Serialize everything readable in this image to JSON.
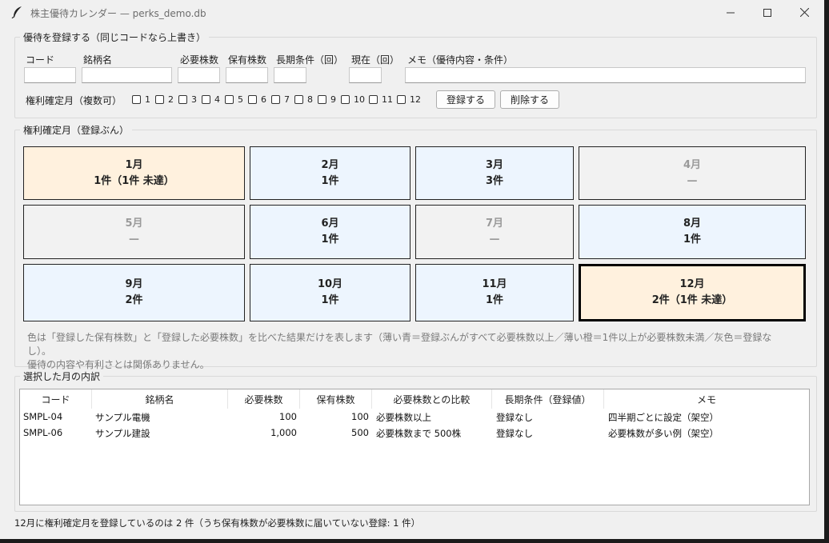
{
  "window": {
    "title": "株主優待カレンダー — perks_demo.db"
  },
  "register": {
    "legend": "優待を登録する（同じコードなら上書き）",
    "labels": {
      "code": "コード",
      "name": "銘柄名",
      "required": "必要株数",
      "held": "保有株数",
      "long_term": "長期条件（回）",
      "current": "現在（回）",
      "memo": "メモ（優待内容・条件）"
    },
    "values": {
      "code": "",
      "name": "",
      "required": "",
      "held": "",
      "long_term": "",
      "current": "",
      "memo": ""
    },
    "months_label": "権利確定月（複数可）",
    "month_checks": [
      "1",
      "2",
      "3",
      "4",
      "5",
      "6",
      "7",
      "8",
      "9",
      "10",
      "11",
      "12"
    ],
    "register_button": "登録する",
    "delete_button": "削除する"
  },
  "calendar": {
    "legend": "権利確定月（登録ぶん）",
    "months": [
      {
        "month": "1月",
        "summary": "1件（1件 未達）",
        "status": "orange"
      },
      {
        "month": "2月",
        "summary": "1件",
        "status": "blue"
      },
      {
        "month": "3月",
        "summary": "3件",
        "status": "blue"
      },
      {
        "month": "4月",
        "summary": "—",
        "status": "gray"
      },
      {
        "month": "5月",
        "summary": "—",
        "status": "gray"
      },
      {
        "month": "6月",
        "summary": "1件",
        "status": "blue"
      },
      {
        "month": "7月",
        "summary": "—",
        "status": "gray"
      },
      {
        "month": "8月",
        "summary": "1件",
        "status": "blue"
      },
      {
        "month": "9月",
        "summary": "2件",
        "status": "blue"
      },
      {
        "month": "10月",
        "summary": "1件",
        "status": "blue"
      },
      {
        "month": "11月",
        "summary": "1件",
        "status": "blue"
      },
      {
        "month": "12月",
        "summary": "2件（1件 未達）",
        "status": "orange",
        "selected": true
      }
    ],
    "note_line1": "色は「登録した保有株数」と「登録した必要株数」を比べた結果だけを表します（薄い青＝登録ぶんがすべて必要株数以上／薄い橙＝1件以上が必要株数未満／灰色＝登録なし）。",
    "note_line2": "優待の内容や有利さとは関係ありません。"
  },
  "detail": {
    "legend": "選択した月の内訳",
    "columns": [
      "コード",
      "銘柄名",
      "必要株数",
      "保有株数",
      "必要株数との比較",
      "長期条件（登録値）",
      "メモ"
    ],
    "rows": [
      [
        "SMPL-04",
        "サンプル電機",
        "100",
        "100",
        "必要株数以上",
        "登録なし",
        "四半期ごとに設定（架空）"
      ],
      [
        "SMPL-06",
        "サンプル建設",
        "1,000",
        "500",
        "必要株数まで 500株",
        "登録なし",
        "必要株数が多い例（架空）"
      ]
    ]
  },
  "status_bar": "12月に権利確定月を登録しているのは 2 件（うち保有株数が必要株数に届いていない登録: 1 件）",
  "colors": {
    "blue": "#edf5fe",
    "orange": "#fff1de",
    "gray": "#f2f2f2"
  }
}
